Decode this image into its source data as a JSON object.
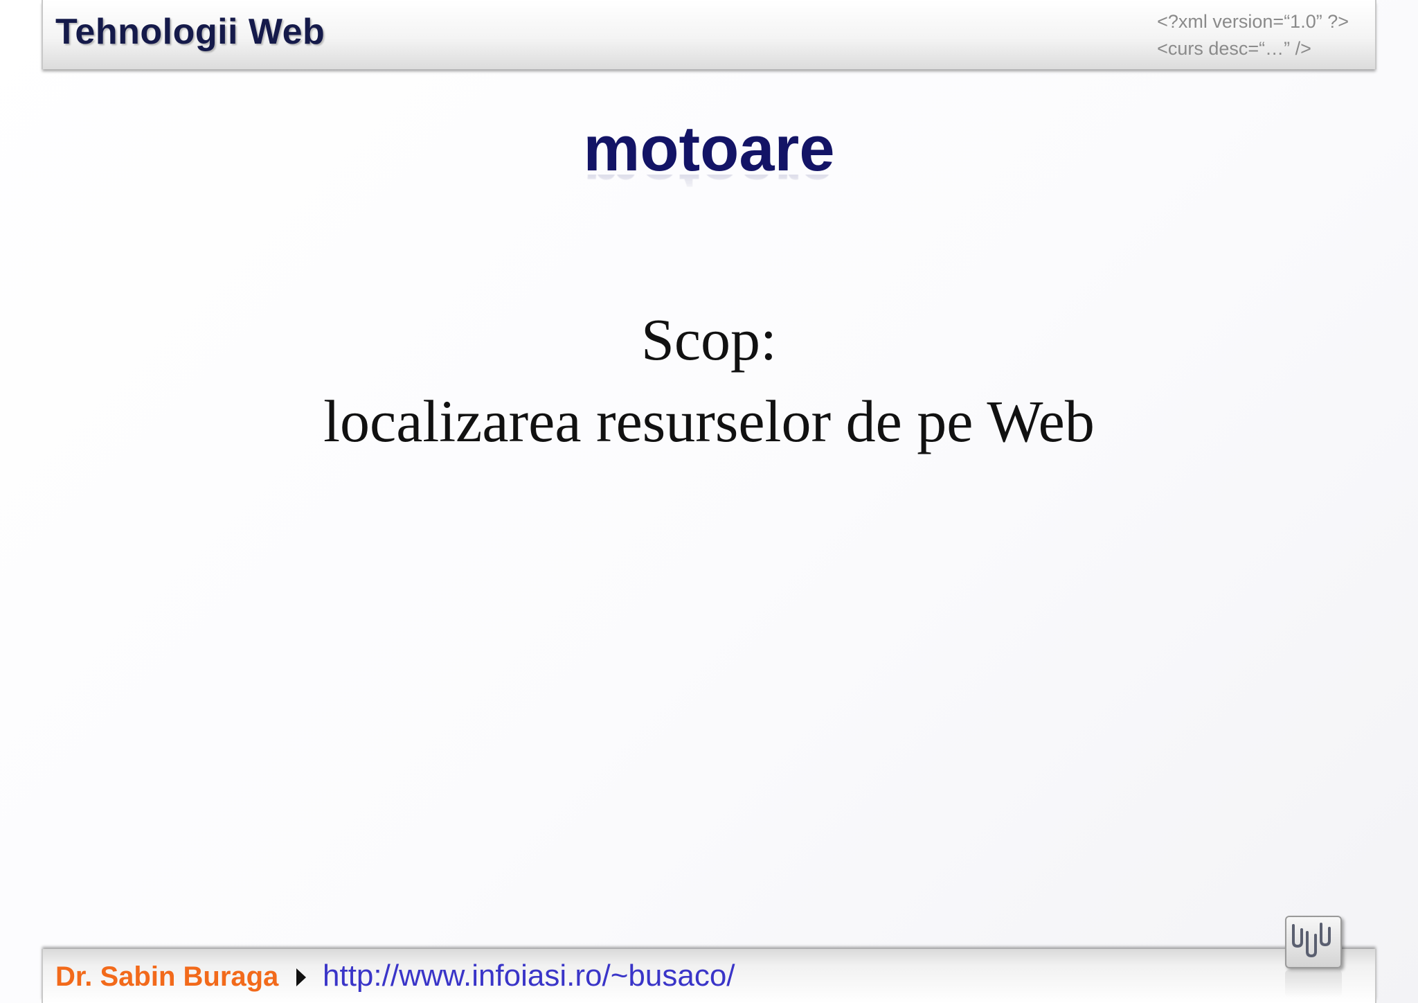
{
  "header": {
    "title": "Tehnologii Web",
    "code_line_1": "<?xml version=“1.0” ?>",
    "code_line_2": "<curs desc=“…” />"
  },
  "slide": {
    "title": "motoare",
    "subtitle_line_1": "Scop:",
    "subtitle_line_2": "localizarea resurselor de pe Web"
  },
  "footer": {
    "author": "Dr. Sabin Buraga",
    "url": "http://www.infoiasi.ro/~busaco/"
  },
  "colors": {
    "title": "#131466",
    "author": "#f26a1b",
    "url": "#3a35c8"
  },
  "icons": {
    "footer_arrow": "play-triangle-icon",
    "logo": "www-logo-icon"
  }
}
